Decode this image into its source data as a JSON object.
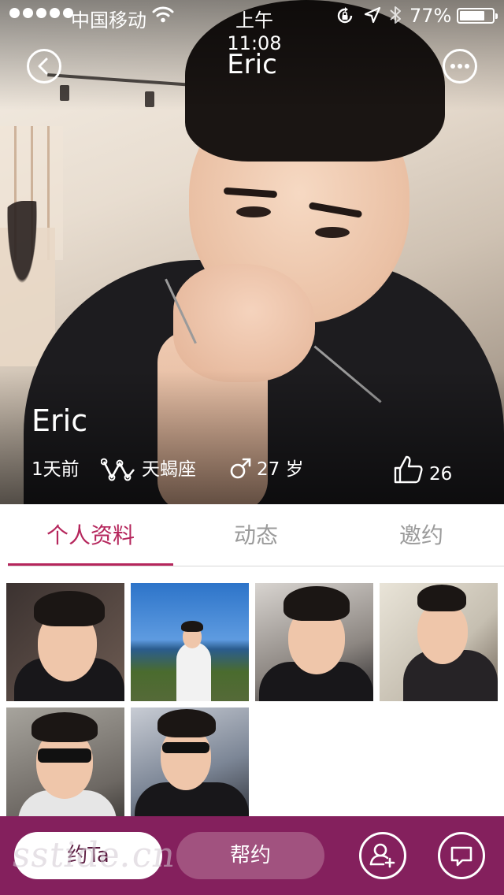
{
  "status_bar": {
    "carrier": "中国移动",
    "time": "上午11:08",
    "battery_percent": "77%",
    "battery_level": 0.77,
    "icons": [
      "signal-dots-icon",
      "wifi-icon",
      "rotation-lock-icon",
      "location-arrow-icon",
      "bluetooth-icon",
      "battery-icon"
    ]
  },
  "nav": {
    "title": "Eric",
    "back_icon": "back-arrow-icon",
    "more_icon": "more-dots-icon"
  },
  "profile": {
    "name": "Eric",
    "last_active": "1天前",
    "zodiac": "天蝎座",
    "zodiac_icon": "scorpio-icon",
    "age": "27 岁",
    "gender_icon": "male-icon",
    "likes": "26",
    "like_icon": "thumbs-up-icon"
  },
  "tabs": [
    {
      "label": "个人资料",
      "active": true
    },
    {
      "label": "动态",
      "active": false
    },
    {
      "label": "邀约",
      "active": false
    }
  ],
  "photos_count": 6,
  "bottom_bar": {
    "date_button": "约Ta",
    "help_button": "帮约",
    "add_friend_icon": "add-friend-icon",
    "message_icon": "message-icon"
  },
  "watermark": "sstide.cn",
  "colors": {
    "accent": "#b5265c",
    "bottom_bar": "#84205d",
    "help_button": "#a1527f",
    "inactive_tab": "#9b9b9b"
  }
}
